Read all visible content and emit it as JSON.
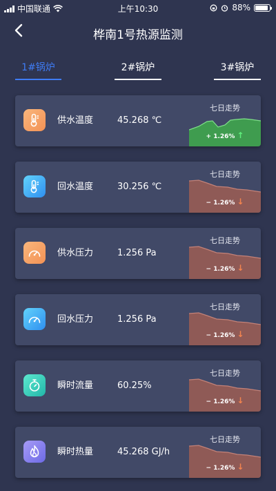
{
  "status_bar": {
    "carrier": "中国联通",
    "time": "上午10:30",
    "battery": "88%",
    "battery_level": 0.88
  },
  "header": {
    "title": "桦南1号热源监测"
  },
  "tabs": [
    {
      "label": "1#锅炉",
      "active": true
    },
    {
      "label": "2#锅炉",
      "active": false
    },
    {
      "label": "3#锅炉",
      "active": false
    }
  ],
  "trend_title": "七日走势",
  "metrics": [
    {
      "label": "供水温度",
      "value": "45.268 ℃",
      "change": "+ 1.26%",
      "direction": "up",
      "icon": "thermometer-icon",
      "icon_colors": [
        "#f9b67c",
        "#f39255"
      ]
    },
    {
      "label": "回水温度",
      "value": "30.256 ℃",
      "change": "− 1.26%",
      "direction": "down",
      "icon": "thermometer-icon",
      "icon_colors": [
        "#62d2fb",
        "#2f8ff0"
      ]
    },
    {
      "label": "供水压力",
      "value": "1.256 Pa",
      "change": "− 1.26%",
      "direction": "down",
      "icon": "gauge-icon",
      "icon_colors": [
        "#f9b67c",
        "#f39255"
      ]
    },
    {
      "label": "回水压力",
      "value": "1.256 Pa",
      "change": "− 1.26%",
      "direction": "down",
      "icon": "gauge-icon",
      "icon_colors": [
        "#62d2fb",
        "#2f8ff0"
      ]
    },
    {
      "label": "瞬时流量",
      "value": "60.25%",
      "change": "− 1.26%",
      "direction": "down",
      "icon": "flow-timer-icon",
      "icon_colors": [
        "#5de8cf",
        "#22b7a9"
      ]
    },
    {
      "label": "瞬时热量",
      "value": "45.268 GJ/h",
      "change": "− 1.26%",
      "direction": "down",
      "icon": "flame-icon",
      "icon_colors": [
        "#a79bf6",
        "#6d6ae6"
      ]
    }
  ],
  "colors": {
    "up_fill": "#3f9c4f",
    "up_line": "#7fe08a",
    "up_arrow": "#5ff07c",
    "down_fill": "#8f5a56",
    "down_line": "#c48278",
    "down_arrow": "#f4844f",
    "tab_active": "#3f7cf5"
  }
}
